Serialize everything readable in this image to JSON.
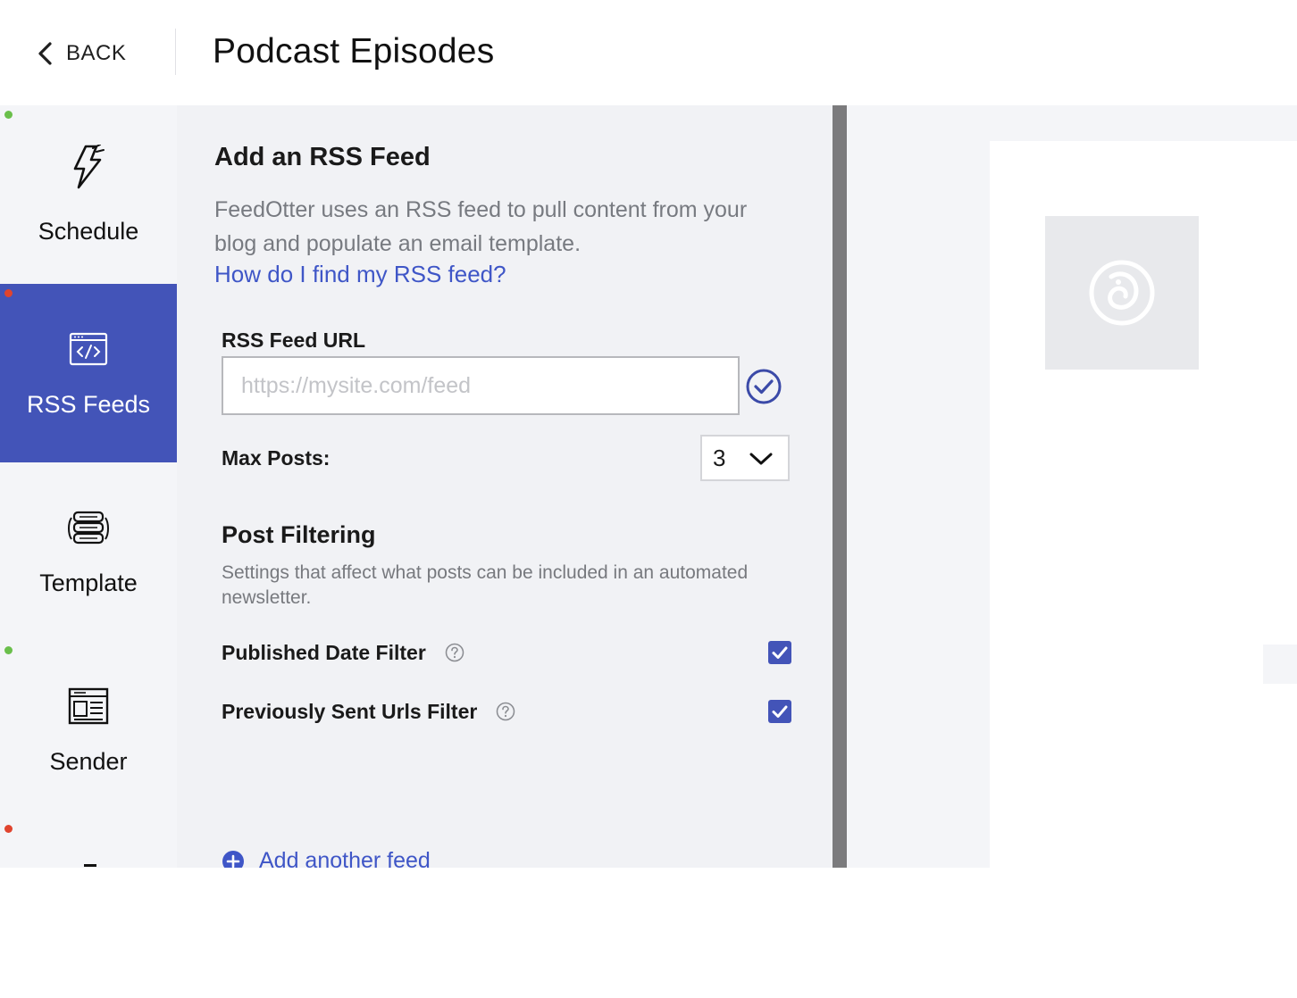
{
  "header": {
    "back_label": "BACK",
    "title": "Podcast Episodes"
  },
  "sidebar": {
    "items": [
      {
        "label": "Schedule",
        "icon": "lightning-icon",
        "status": "green",
        "active": false
      },
      {
        "label": "RSS Feeds",
        "icon": "code-window-icon",
        "status": "red",
        "active": true
      },
      {
        "label": "Template",
        "icon": "template-stack-icon",
        "status": "none",
        "active": false
      },
      {
        "label": "Sender",
        "icon": "newsletter-icon",
        "status": "green",
        "active": false
      },
      {
        "label": "",
        "icon": "",
        "status": "red",
        "active": false
      }
    ]
  },
  "form": {
    "section_title": "Add an RSS Feed",
    "description": "FeedOtter uses an RSS feed to pull content from your blog and populate an email template.",
    "help_link": "How do I find my RSS feed?",
    "url_label": "RSS Feed URL",
    "url_placeholder": "https://mysite.com/feed",
    "url_value": "",
    "max_posts_label": "Max Posts:",
    "max_posts_value": "3",
    "filter_title": "Post Filtering",
    "filter_description": "Settings that affect what posts can be included in an automated newsletter.",
    "filters": [
      {
        "label": "Published Date Filter",
        "checked": true
      },
      {
        "label": "Previously Sent Urls Filter",
        "checked": true
      }
    ],
    "add_feed_label": "Add another feed"
  },
  "colors": {
    "accent": "#4354b8",
    "link": "#3f56c7",
    "status_green": "#6abf4b",
    "status_red": "#e0442e"
  }
}
